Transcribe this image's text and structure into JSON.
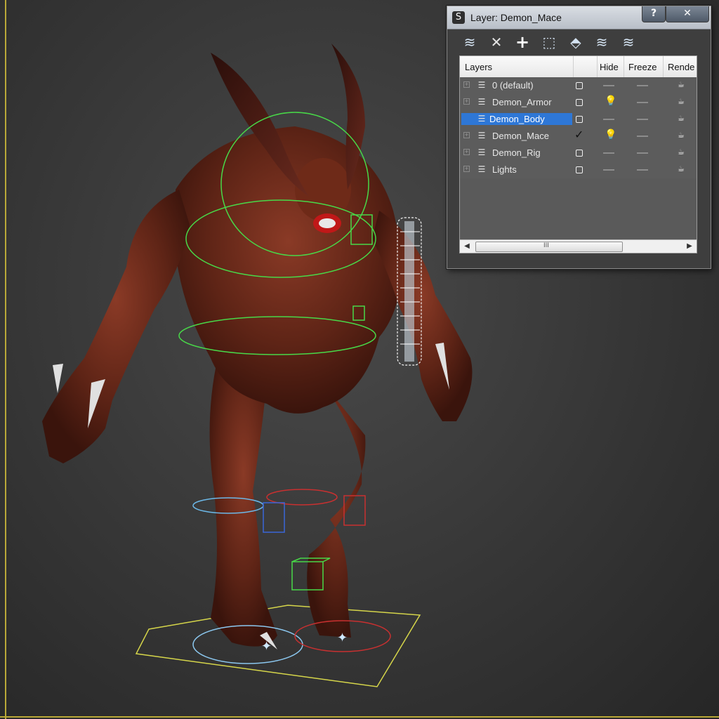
{
  "dialog": {
    "title": "Layer: Demon_Mace",
    "app_glyph": "S",
    "help_label": "?",
    "close_label": "✕",
    "toolbar": [
      {
        "icon": "create-layer-icon",
        "glyph": "≋"
      },
      {
        "icon": "delete-layer-icon",
        "glyph": "✕"
      },
      {
        "icon": "add-to-layer-icon",
        "glyph": "+"
      },
      {
        "icon": "select-objects-icon",
        "glyph": "⬚"
      },
      {
        "icon": "highlight-layer-icon",
        "glyph": "⬘"
      },
      {
        "icon": "hide-all-icon",
        "glyph": "≋"
      },
      {
        "icon": "freeze-all-icon",
        "glyph": "≋"
      }
    ],
    "columns": [
      "Layers",
      "",
      "Hide",
      "Freeze",
      "Rende"
    ],
    "layers": [
      {
        "name": "0 (default)",
        "current": false,
        "hidden_icon": "dash",
        "freeze": "dash"
      },
      {
        "name": "Demon_Armor",
        "current": false,
        "hidden_icon": "bulb",
        "freeze": "dash"
      },
      {
        "name": "Demon_Body",
        "current": false,
        "hidden_icon": "dash",
        "freeze": "dash",
        "selected": true
      },
      {
        "name": "Demon_Mace",
        "current": true,
        "hidden_icon": "bulb",
        "freeze": "dash"
      },
      {
        "name": "Demon_Rig",
        "current": false,
        "hidden_icon": "dash",
        "freeze": "dash"
      },
      {
        "name": "Lights",
        "current": false,
        "hidden_icon": "dash",
        "freeze": "dash"
      }
    ],
    "scroll_grip": "III",
    "colors": {
      "selection": "#2e77d6",
      "viewport_border": "#b9a838"
    }
  },
  "viewport": {
    "object_name": "demon character model"
  }
}
